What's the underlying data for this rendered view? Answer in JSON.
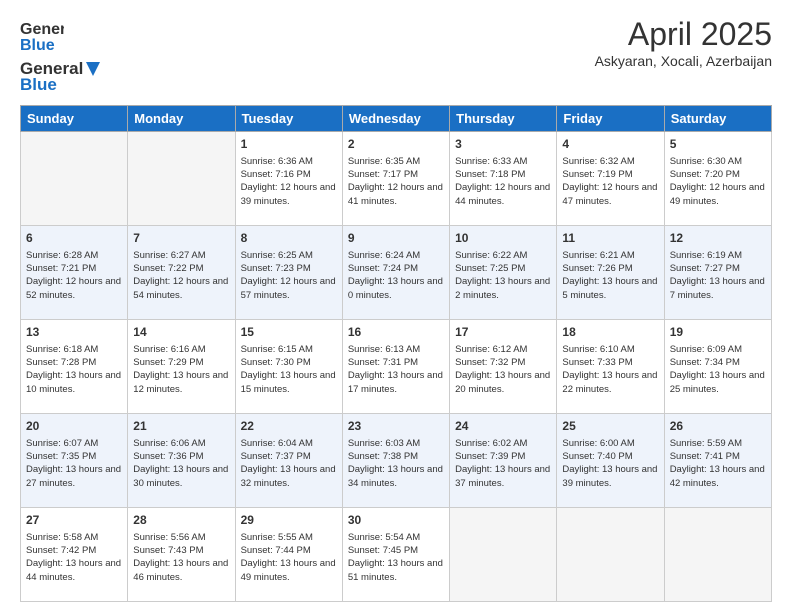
{
  "header": {
    "logo_general": "General",
    "logo_blue": "Blue",
    "month_title": "April 2025",
    "location": "Askyaran, Xocali, Azerbaijan"
  },
  "days_of_week": [
    "Sunday",
    "Monday",
    "Tuesday",
    "Wednesday",
    "Thursday",
    "Friday",
    "Saturday"
  ],
  "weeks": [
    [
      {
        "day": "",
        "info": ""
      },
      {
        "day": "",
        "info": ""
      },
      {
        "day": "1",
        "info": "Sunrise: 6:36 AM\nSunset: 7:16 PM\nDaylight: 12 hours and 39 minutes."
      },
      {
        "day": "2",
        "info": "Sunrise: 6:35 AM\nSunset: 7:17 PM\nDaylight: 12 hours and 41 minutes."
      },
      {
        "day": "3",
        "info": "Sunrise: 6:33 AM\nSunset: 7:18 PM\nDaylight: 12 hours and 44 minutes."
      },
      {
        "day": "4",
        "info": "Sunrise: 6:32 AM\nSunset: 7:19 PM\nDaylight: 12 hours and 47 minutes."
      },
      {
        "day": "5",
        "info": "Sunrise: 6:30 AM\nSunset: 7:20 PM\nDaylight: 12 hours and 49 minutes."
      }
    ],
    [
      {
        "day": "6",
        "info": "Sunrise: 6:28 AM\nSunset: 7:21 PM\nDaylight: 12 hours and 52 minutes."
      },
      {
        "day": "7",
        "info": "Sunrise: 6:27 AM\nSunset: 7:22 PM\nDaylight: 12 hours and 54 minutes."
      },
      {
        "day": "8",
        "info": "Sunrise: 6:25 AM\nSunset: 7:23 PM\nDaylight: 12 hours and 57 minutes."
      },
      {
        "day": "9",
        "info": "Sunrise: 6:24 AM\nSunset: 7:24 PM\nDaylight: 13 hours and 0 minutes."
      },
      {
        "day": "10",
        "info": "Sunrise: 6:22 AM\nSunset: 7:25 PM\nDaylight: 13 hours and 2 minutes."
      },
      {
        "day": "11",
        "info": "Sunrise: 6:21 AM\nSunset: 7:26 PM\nDaylight: 13 hours and 5 minutes."
      },
      {
        "day": "12",
        "info": "Sunrise: 6:19 AM\nSunset: 7:27 PM\nDaylight: 13 hours and 7 minutes."
      }
    ],
    [
      {
        "day": "13",
        "info": "Sunrise: 6:18 AM\nSunset: 7:28 PM\nDaylight: 13 hours and 10 minutes."
      },
      {
        "day": "14",
        "info": "Sunrise: 6:16 AM\nSunset: 7:29 PM\nDaylight: 13 hours and 12 minutes."
      },
      {
        "day": "15",
        "info": "Sunrise: 6:15 AM\nSunset: 7:30 PM\nDaylight: 13 hours and 15 minutes."
      },
      {
        "day": "16",
        "info": "Sunrise: 6:13 AM\nSunset: 7:31 PM\nDaylight: 13 hours and 17 minutes."
      },
      {
        "day": "17",
        "info": "Sunrise: 6:12 AM\nSunset: 7:32 PM\nDaylight: 13 hours and 20 minutes."
      },
      {
        "day": "18",
        "info": "Sunrise: 6:10 AM\nSunset: 7:33 PM\nDaylight: 13 hours and 22 minutes."
      },
      {
        "day": "19",
        "info": "Sunrise: 6:09 AM\nSunset: 7:34 PM\nDaylight: 13 hours and 25 minutes."
      }
    ],
    [
      {
        "day": "20",
        "info": "Sunrise: 6:07 AM\nSunset: 7:35 PM\nDaylight: 13 hours and 27 minutes."
      },
      {
        "day": "21",
        "info": "Sunrise: 6:06 AM\nSunset: 7:36 PM\nDaylight: 13 hours and 30 minutes."
      },
      {
        "day": "22",
        "info": "Sunrise: 6:04 AM\nSunset: 7:37 PM\nDaylight: 13 hours and 32 minutes."
      },
      {
        "day": "23",
        "info": "Sunrise: 6:03 AM\nSunset: 7:38 PM\nDaylight: 13 hours and 34 minutes."
      },
      {
        "day": "24",
        "info": "Sunrise: 6:02 AM\nSunset: 7:39 PM\nDaylight: 13 hours and 37 minutes."
      },
      {
        "day": "25",
        "info": "Sunrise: 6:00 AM\nSunset: 7:40 PM\nDaylight: 13 hours and 39 minutes."
      },
      {
        "day": "26",
        "info": "Sunrise: 5:59 AM\nSunset: 7:41 PM\nDaylight: 13 hours and 42 minutes."
      }
    ],
    [
      {
        "day": "27",
        "info": "Sunrise: 5:58 AM\nSunset: 7:42 PM\nDaylight: 13 hours and 44 minutes."
      },
      {
        "day": "28",
        "info": "Sunrise: 5:56 AM\nSunset: 7:43 PM\nDaylight: 13 hours and 46 minutes."
      },
      {
        "day": "29",
        "info": "Sunrise: 5:55 AM\nSunset: 7:44 PM\nDaylight: 13 hours and 49 minutes."
      },
      {
        "day": "30",
        "info": "Sunrise: 5:54 AM\nSunset: 7:45 PM\nDaylight: 13 hours and 51 minutes."
      },
      {
        "day": "",
        "info": ""
      },
      {
        "day": "",
        "info": ""
      },
      {
        "day": "",
        "info": ""
      }
    ]
  ]
}
